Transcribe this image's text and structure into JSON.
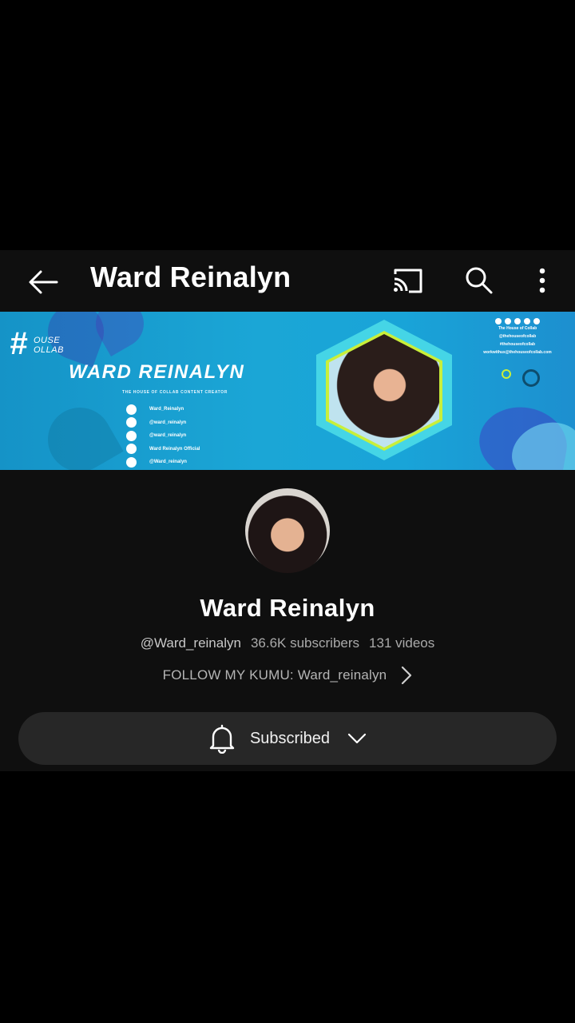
{
  "topbar": {
    "title": "Ward Reinalyn",
    "icons": [
      "back-arrow-icon",
      "cast-icon",
      "search-icon",
      "more-vert-icon"
    ]
  },
  "banner": {
    "logo_hash": "#",
    "logo_line1": "OUSE",
    "logo_line2": "OLLAB",
    "name": "WARD REINALYN",
    "tagline": "THE HOUSE OF COLLAB CONTENT CREATOR",
    "socials": [
      "Ward_Reinalyn",
      "@ward_reinalyn",
      "@ward_reinalyn",
      "Ward Reinalyn Official",
      "@Ward_reinalyn"
    ],
    "right_lines": [
      "The House of Collab",
      "@thehouseofcollab",
      "#thehouseofcollab",
      "workwithus@thehouseofcollab.com"
    ]
  },
  "channel": {
    "name": "Ward Reinalyn",
    "handle": "@Ward_reinalyn",
    "subscribers": "36.6K subscribers",
    "videos": "131 videos",
    "link": "FOLLOW MY KUMU: Ward_reinalyn"
  },
  "subscribe": {
    "label": "Subscribed",
    "state": "subscribed"
  },
  "colors": {
    "background": "#0f0f0f",
    "button": "#272727",
    "banner_blue": "#1ba6d6",
    "accent_lime": "#c9ef3a"
  }
}
